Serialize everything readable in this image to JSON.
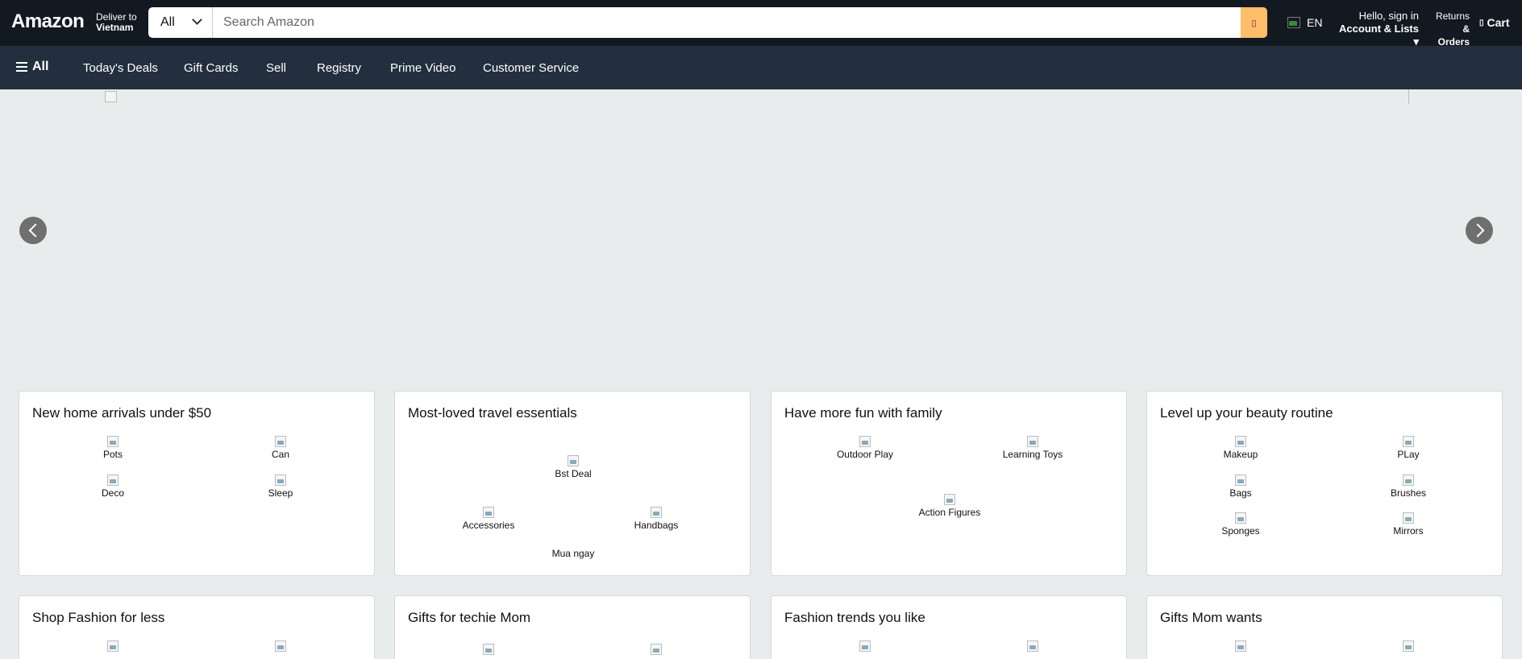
{
  "header": {
    "logo": "Amazon",
    "deliver_line1": "Deliver to",
    "deliver_line2": "Vietnam",
    "search_category": "All",
    "search_placeholder": "Search Amazon",
    "language": "EN",
    "account_line1": "Hello, sign in",
    "account_line2": "Account & Lists ▾",
    "returns_line1": "Returns",
    "returns_line2": "& Orders",
    "cart_label": "Cart"
  },
  "nav": {
    "all_label": "All",
    "items": [
      "Today's Deals",
      "Gift Cards",
      "Sell",
      "Registry",
      "Prime Video",
      "Customer Service"
    ]
  },
  "cards_row1": [
    {
      "title": "New home arrivals under $50",
      "tiles": [
        "Pots",
        "Can",
        "Deco",
        "Sleep"
      ]
    },
    {
      "title": "Most-loved travel essentials",
      "tiles": [
        "Bst Deal",
        "Accessories",
        "Handbags",
        "Mua ngay"
      ]
    },
    {
      "title": "Have more fun with family",
      "tiles": [
        "Outdoor Play",
        "Learning Toys",
        "Action Figures"
      ]
    },
    {
      "title": "Level up your beauty routine",
      "tiles": [
        "Makeup",
        "PLay",
        "Bags",
        "Brushes",
        "Sponges",
        "Mirrors"
      ]
    }
  ],
  "cards_row2": [
    {
      "title": "Shop Fashion for less"
    },
    {
      "title": "Gifts for techie Mom"
    },
    {
      "title": "Fashion trends you like"
    },
    {
      "title": "Gifts Mom wants"
    }
  ],
  "colors": {
    "topbar": "#131921",
    "navbar": "#232f3e",
    "search_button": "#febd69",
    "page_bg": "#e8ecec"
  }
}
